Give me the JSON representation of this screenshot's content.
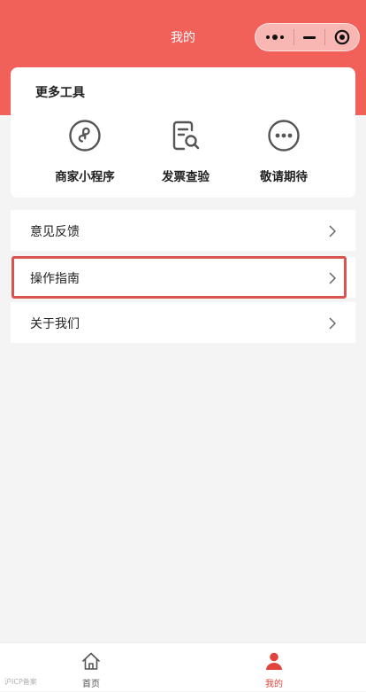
{
  "header": {
    "title": "我的",
    "capsule": {
      "more_icon": "more-dots-icon",
      "minimize_icon": "minimize-icon",
      "close_icon": "target-circle-icon"
    }
  },
  "tools": {
    "title": "更多工具",
    "items": [
      {
        "label": "商家小程序",
        "icon": "mini-program-icon"
      },
      {
        "label": "发票查验",
        "icon": "invoice-search-icon"
      },
      {
        "label": "敬请期待",
        "icon": "more-circle-icon"
      }
    ]
  },
  "menu": [
    {
      "label": "意见反馈",
      "icon": "chevron-right-icon"
    },
    {
      "label": "操作指南",
      "icon": "chevron-right-icon",
      "highlighted": true
    },
    {
      "label": "关于我们",
      "icon": "chevron-right-icon"
    }
  ],
  "tabbar": [
    {
      "label": "首页",
      "icon": "home-icon",
      "active": false
    },
    {
      "label": "我的",
      "icon": "person-icon",
      "active": true
    }
  ],
  "watermark": "沪ICP备案",
  "colors": {
    "accent": "#f2605a",
    "highlight_border": "#d9534f",
    "icon_gray": "#555555",
    "tab_inactive": "#555555",
    "tab_active": "#e0443c"
  }
}
